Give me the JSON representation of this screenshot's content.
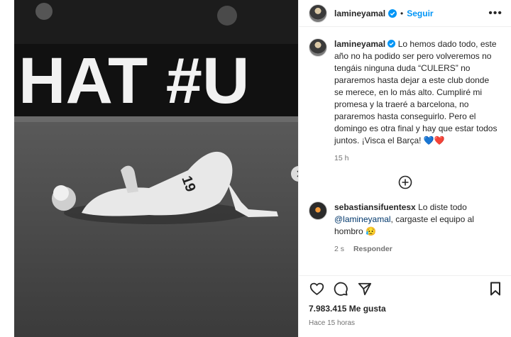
{
  "post": {
    "image_text": "HAT #U",
    "jersey_number": "19"
  },
  "header": {
    "username": "lamineyamal",
    "separator": "•",
    "follow_label": "Seguir",
    "more_label": "•••"
  },
  "caption": {
    "username": "lamineyamal",
    "text": "Lo hemos dado todo, este año no ha podido ser pero volveremos no tengáis ninguna duda “CULERS” no pararemos hasta dejar a este club donde se merece, en lo más alto. Cumpliré mi promesa y la traeré a barcelona, no pararemos hasta conseguirlo. Pero el domingo es otra final y hay que estar todos juntos. ¡Visca el Barça! 💙❤️",
    "time": "15 h"
  },
  "comment": {
    "username": "sebastiansifuentesx",
    "text_before": "Lo diste todo",
    "mention": "@lamineyamal",
    "text_after": ", cargaste el equipo al hombro 😥",
    "time": "2 s",
    "reply_label": "Responder"
  },
  "footer": {
    "likes": "7.983.415 Me gusta",
    "posted": "Hace 15 horas"
  },
  "colors": {
    "accent": "#0095f6",
    "mention": "#00376b",
    "muted": "#737373"
  }
}
